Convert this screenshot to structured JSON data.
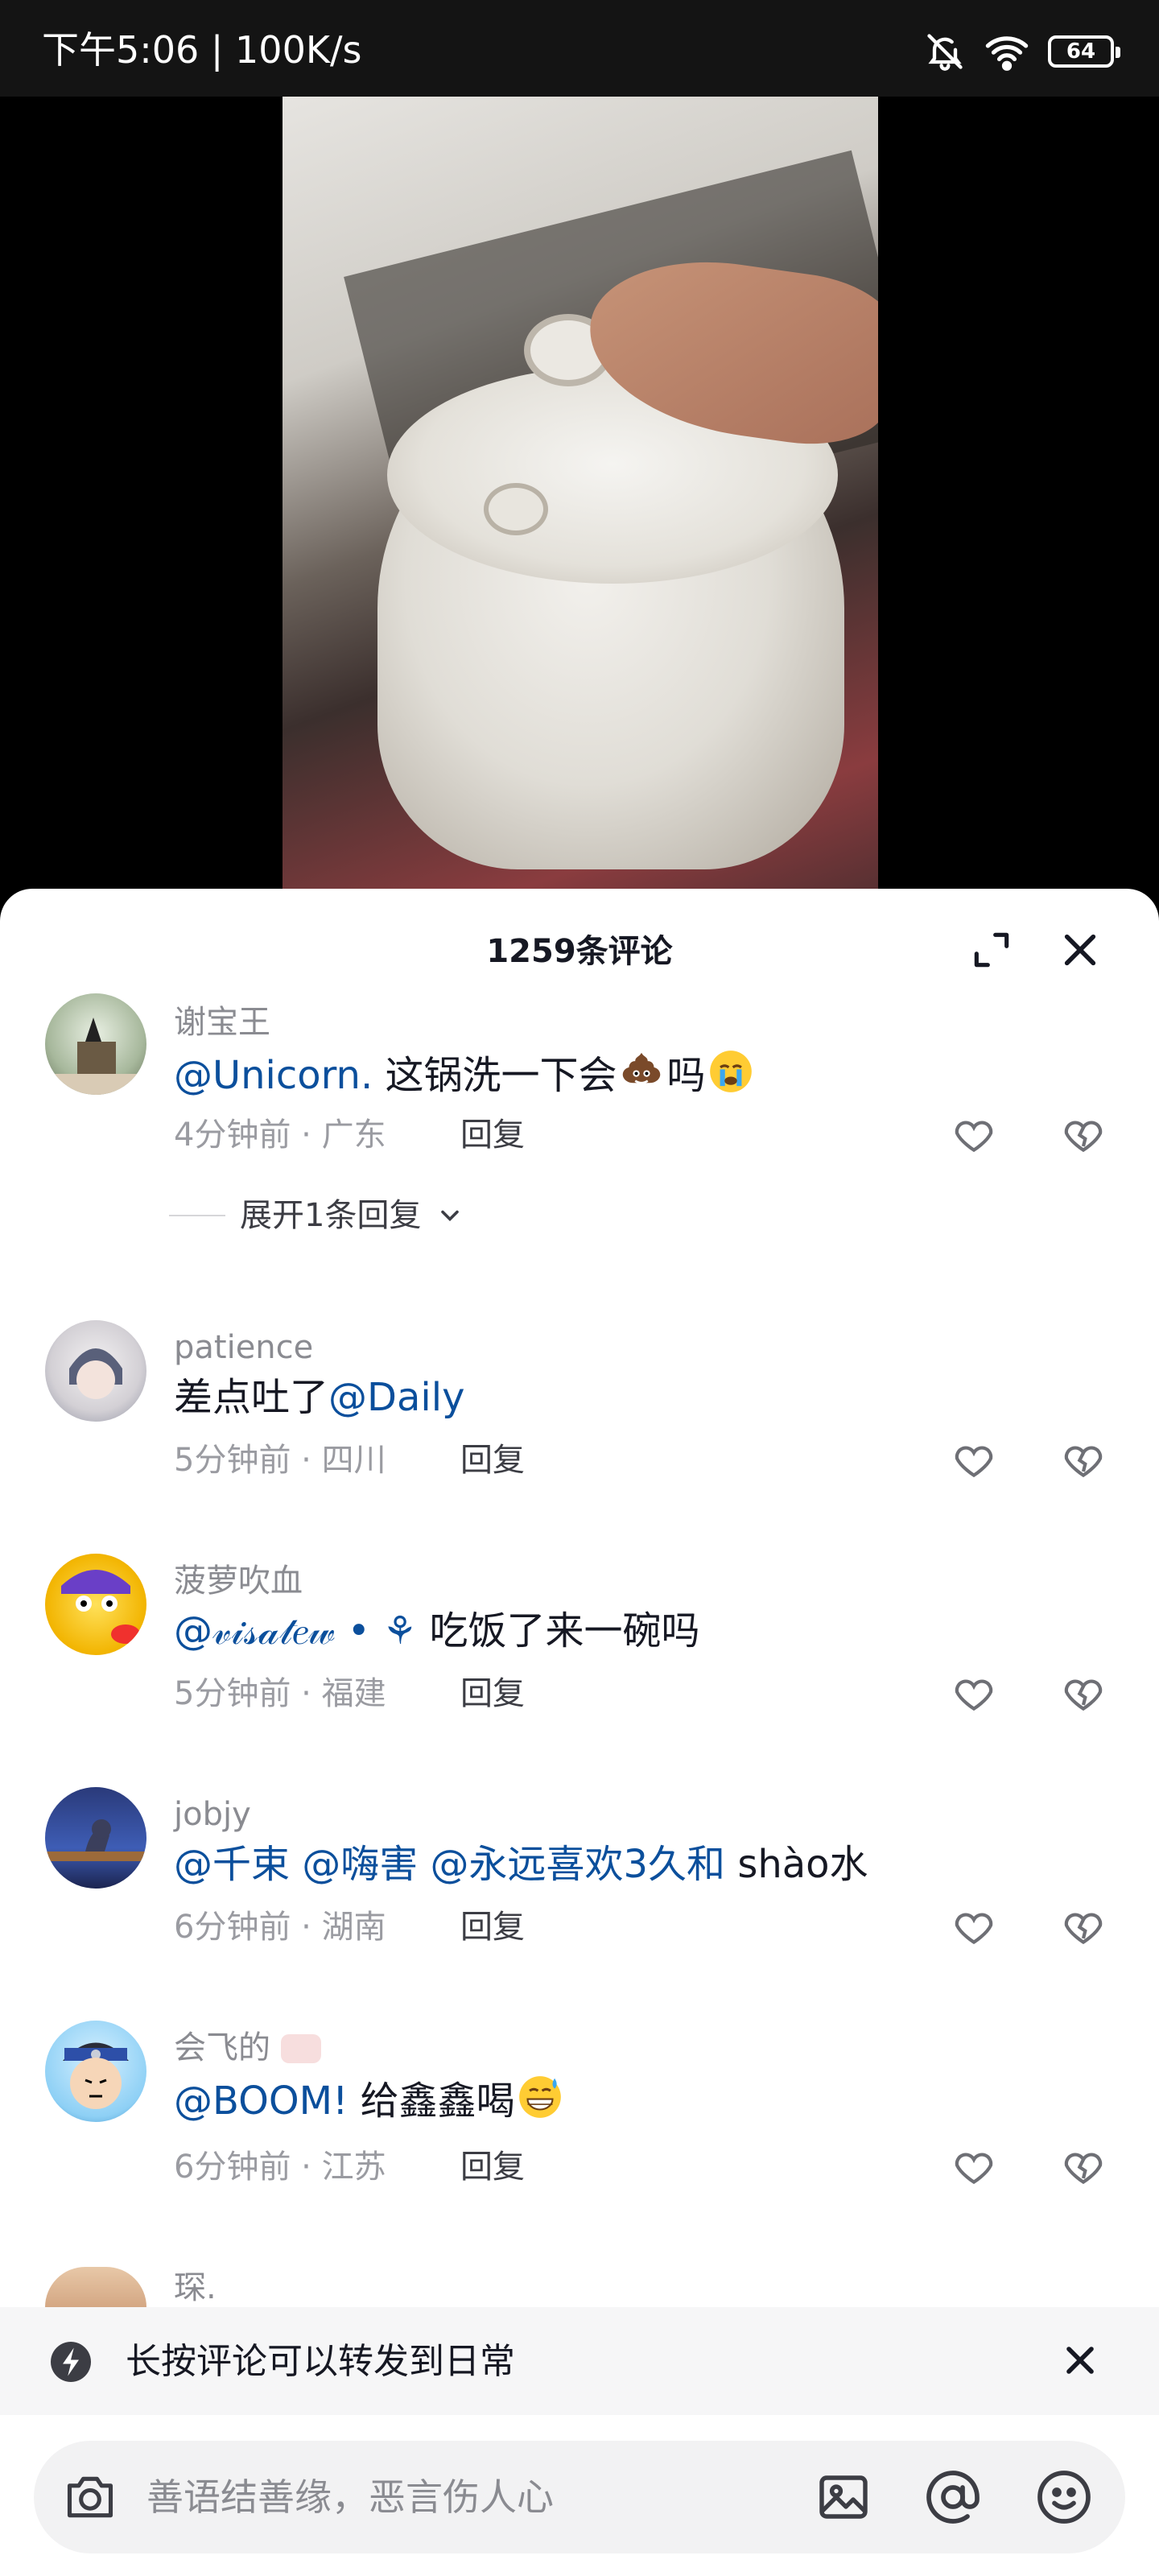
{
  "status_bar": {
    "time": "下午5:06 | 100K/s",
    "battery": "64",
    "icons": [
      "mute-bell-icon",
      "wifi-icon",
      "battery-icon"
    ]
  },
  "sheet": {
    "title": "1259条评论"
  },
  "comments": [
    {
      "username": "谢宝王",
      "mention": "@Unicorn.",
      "text": " 这锅洗一下会",
      "text_after_emoji": "吗",
      "emojis": [
        "poop-emoji",
        "crying-emoji"
      ],
      "time": "4分钟前",
      "location": "广东",
      "reply": "回复",
      "expand": "展开1条回复"
    },
    {
      "username": "patience",
      "text": "差点吐了",
      "mention": "@Daily",
      "time": "5分钟前",
      "location": "四川",
      "reply": "回复"
    },
    {
      "username": "菠萝吹血",
      "mention": "@𝓋𝒾𝓈𝒶𝓉𝑒𝓌 • ⚘",
      "text": " 吃饭了来一碗吗",
      "time": "5分钟前",
      "location": "福建",
      "reply": "回复"
    },
    {
      "username": "jobjy",
      "mention": "@千束 @嗨害 @永远喜欢3久和",
      "text": " shào水",
      "time": "6分钟前",
      "location": "湖南",
      "reply": "回复"
    },
    {
      "username": "会飞的",
      "mention": "@BOOM!",
      "text": "  给鑫鑫喝",
      "time": "6分钟前",
      "location": "江苏",
      "reply": "回复"
    },
    {
      "username": "琛."
    }
  ],
  "tip": {
    "text": "长按评论可以转发到日常"
  },
  "input": {
    "placeholder": "善语结善缘，恶言伤人心"
  },
  "colors": {
    "mention": "#0b4f9c",
    "meta": "#9a9ba1",
    "text": "#161823"
  }
}
